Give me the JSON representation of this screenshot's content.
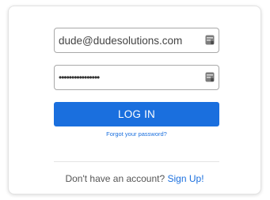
{
  "login_form": {
    "email_value": "dude@dudesolutions.com",
    "password_value": "••••••••••••••••",
    "login_button_label": "LOG IN",
    "forgot_password_link": "Forgot your password?",
    "signup_prompt": "Don't have an account?",
    "signup_link": "Sign Up!"
  },
  "icons": {
    "email_field_icon": "password-manager-key-icon",
    "password_field_icon": "password-manager-key-icon"
  },
  "colors": {
    "accent": "#1a6fde",
    "button_text": "#ffffff",
    "card_border": "#e2e2e2",
    "field_border": "#a9a9a9"
  }
}
